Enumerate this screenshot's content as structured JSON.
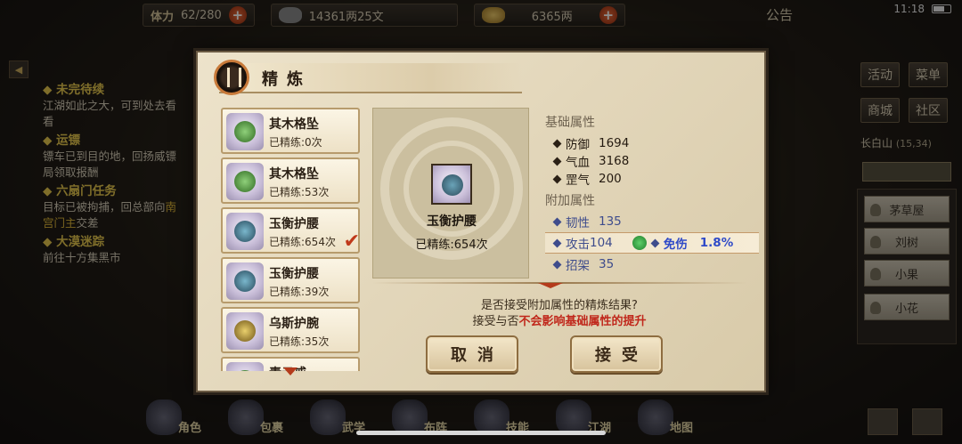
{
  "topbar": {
    "stamina_label": "体力",
    "stamina_value": "62/280",
    "silver_value": "14361两25文",
    "gold_value": "6365两",
    "notice_label": "公告",
    "time": "11:18"
  },
  "quests": [
    {
      "title": "未完待续",
      "desc": "江湖如此之大，可到处去看看"
    },
    {
      "title": "运镖",
      "desc": "镖车已到目的地，回扬威镖局领取报酬"
    },
    {
      "title": "六扇门任务",
      "desc_pre": "目标已被拘捕，回总部向",
      "desc_hl": "南宫门主",
      "desc_post": "交差"
    },
    {
      "title": "大漠迷踪",
      "desc": "前往十方集黑市"
    }
  ],
  "right_panel": {
    "buttons": [
      "活动",
      "菜单",
      "商城",
      "社区"
    ],
    "location_name": "长白山",
    "location_coords": "(15,34)",
    "npcs": [
      "茅草屋",
      "刘树",
      "小果",
      "小花"
    ]
  },
  "bottom_menu": [
    "角色",
    "包裹",
    "武学",
    "布阵",
    "技能",
    "江湖",
    "地图"
  ],
  "modal": {
    "title": "精炼",
    "items": [
      {
        "name": "其木格坠",
        "refine": "已精练:0次",
        "gem_color": "#5aa04a"
      },
      {
        "name": "其木格坠",
        "refine": "已精练:53次",
        "gem_color": "#5aa04a"
      },
      {
        "name": "玉衡护腰",
        "refine": "已精练:654次",
        "gem_color": "#3f7f96"
      },
      {
        "name": "玉衡护腰",
        "refine": "已精练:39次",
        "gem_color": "#3f7f96"
      },
      {
        "name": "乌斯护腕",
        "refine": "已精练:35次",
        "gem_color": "#c7a63a"
      },
      {
        "name": "素云戒",
        "refine": "",
        "gem_color": "#5aa04a"
      }
    ],
    "selected": {
      "name": "玉衡护腰",
      "refine": "已精练:654次"
    },
    "base_label": "基础属性",
    "base_attrs": [
      {
        "name": "防御",
        "value": "1694"
      },
      {
        "name": "气血",
        "value": "3168"
      },
      {
        "name": "罡气",
        "value": "200"
      }
    ],
    "extra_label": "附加属性",
    "extra_attrs": [
      {
        "name": "韧性",
        "value": "135"
      },
      {
        "name": "攻击",
        "value": "104"
      },
      {
        "name": "招架",
        "value": "35"
      }
    ],
    "new_attr": {
      "name": "免伤",
      "value": "1.8%"
    },
    "prompt_line1": "是否接受附加属性的精炼结果?",
    "prompt_line2_pre": "接受与否",
    "prompt_line2_red": "不会影响基础属性的提升",
    "cancel_label": "取消",
    "accept_label": "接受"
  }
}
